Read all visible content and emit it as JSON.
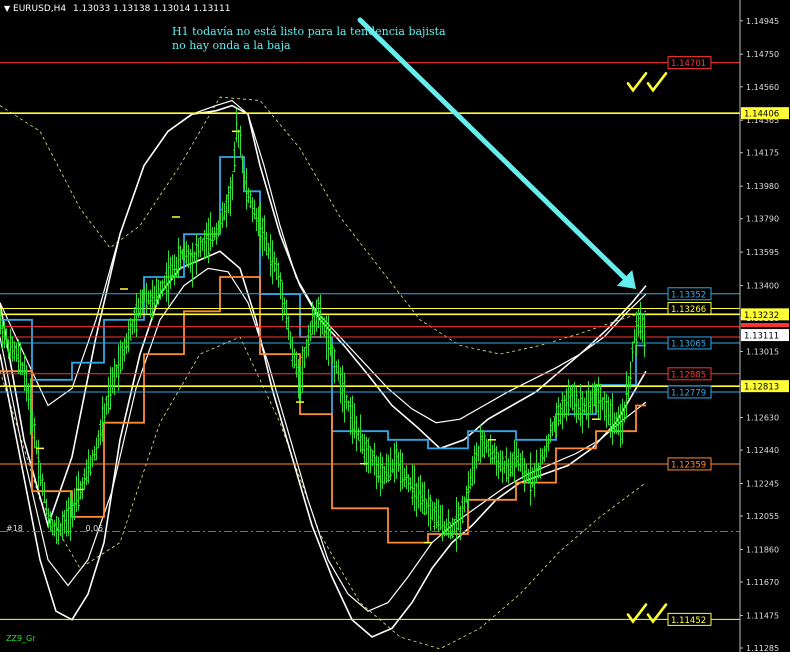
{
  "header": {
    "symbol": "EURUSD,H4",
    "ohlc": "1.13033 1.13138 1.13014 1.13111"
  },
  "note": {
    "line1": "H1 todavía no está listo para la tendencia bajista",
    "line2": "no hay onda a la baja"
  },
  "lower_left_text": "#18",
  "lower_left_value": "0.05",
  "footer_text": "ZZ9_Gr",
  "colors": {
    "background": "#000000",
    "candles": "#33dd33",
    "yellow": "#ffff33",
    "red": "#ff3333",
    "blue": "#33a8e8",
    "orange": "#ff8c33",
    "white": "#ffffff",
    "arrow": "#66eeee"
  },
  "chart_data": {
    "type": "line",
    "ylim": [
      1.11285,
      1.15043
    ],
    "y_ticks": [
      "1.14945",
      "1.14750",
      "1.14560",
      "1.14365",
      "1.14175",
      "1.13980",
      "1.13790",
      "1.13595",
      "1.13400",
      "1.13210",
      "1.13015",
      "1.12825",
      "1.12630",
      "1.12440",
      "1.12245",
      "1.12055",
      "1.11860",
      "1.11670",
      "1.11475",
      "1.11285"
    ],
    "current_price": "1.13111",
    "price_lines": [
      {
        "label": "1.14701",
        "value": 1.14701,
        "color": "#ff3333",
        "style": "boxed-right"
      },
      {
        "label": "1.14406",
        "value": 1.14406,
        "color": "#ffff33",
        "style": "axis-tag"
      },
      {
        "label": "1.13352",
        "value": 1.13352,
        "color": "#33a8e8",
        "style": "boxed-right"
      },
      {
        "label": "1.13266",
        "value": 1.13266,
        "color": "#ffff33",
        "style": "boxed-right"
      },
      {
        "label": "1.13232",
        "value": 1.13232,
        "color": "#ffff33",
        "style": "axis-tag"
      },
      {
        "label": "1.13065",
        "value": 1.13065,
        "color": "#33a8e8",
        "style": "boxed-right"
      },
      {
        "label": "1.12885",
        "value": 1.12885,
        "color": "#ff3333",
        "style": "boxed-right"
      },
      {
        "label": "1.12813",
        "value": 1.12813,
        "color": "#ffff33",
        "style": "axis-tag"
      },
      {
        "label": "1.12779",
        "value": 1.12779,
        "color": "#33a8e8",
        "style": "boxed-right"
      },
      {
        "label": "1.12359",
        "value": 1.12359,
        "color": "#ff8c33",
        "style": "boxed-right"
      },
      {
        "label": "1.11452",
        "value": 1.11452,
        "color": "#ffff33",
        "style": "boxed-right"
      }
    ],
    "unlabeled_lines": [
      {
        "value": 1.1316,
        "color": "#ff3333"
      },
      {
        "value": 1.131,
        "color": "#ff3333"
      },
      {
        "value": 1.11965,
        "color": "#ff3333",
        "dash": true
      }
    ],
    "price_path": [
      [
        0,
        1.1317
      ],
      [
        4,
        1.1305
      ],
      [
        8,
        1.13
      ],
      [
        12,
        1.129
      ],
      [
        16,
        1.1262
      ],
      [
        20,
        1.123
      ],
      [
        24,
        1.1205
      ],
      [
        28,
        1.1196
      ],
      [
        32,
        1.1201
      ],
      [
        36,
        1.121
      ],
      [
        40,
        1.122
      ],
      [
        44,
        1.1232
      ],
      [
        48,
        1.1245
      ],
      [
        52,
        1.1265
      ],
      [
        56,
        1.1283
      ],
      [
        60,
        1.1298
      ],
      [
        64,
        1.131
      ],
      [
        68,
        1.1322
      ],
      [
        72,
        1.1335
      ],
      [
        76,
        1.133
      ],
      [
        80,
        1.1338
      ],
      [
        84,
        1.1345
      ],
      [
        88,
        1.1352
      ],
      [
        92,
        1.136
      ],
      [
        96,
        1.1355
      ],
      [
        100,
        1.1363
      ],
      [
        104,
        1.1366
      ],
      [
        108,
        1.1372
      ],
      [
        112,
        1.1382
      ],
      [
        116,
        1.1398
      ],
      [
        118,
        1.143
      ],
      [
        120,
        1.1425
      ],
      [
        122,
        1.14
      ],
      [
        126,
        1.1385
      ],
      [
        130,
        1.1375
      ],
      [
        134,
        1.136
      ],
      [
        138,
        1.135
      ],
      [
        142,
        1.133
      ],
      [
        146,
        1.13
      ],
      [
        150,
        1.1285
      ],
      [
        154,
        1.131
      ],
      [
        158,
        1.1325
      ],
      [
        162,
        1.1315
      ],
      [
        166,
        1.13
      ],
      [
        170,
        1.1285
      ],
      [
        174,
        1.127
      ],
      [
        178,
        1.1255
      ],
      [
        182,
        1.1245
      ],
      [
        186,
        1.124
      ],
      [
        190,
        1.1228
      ],
      [
        194,
        1.1232
      ],
      [
        198,
        1.1238
      ],
      [
        202,
        1.123
      ],
      [
        206,
        1.1222
      ],
      [
        210,
        1.1215
      ],
      [
        214,
        1.121
      ],
      [
        218,
        1.1205
      ],
      [
        222,
        1.12
      ],
      [
        226,
        1.1198
      ],
      [
        230,
        1.1205
      ],
      [
        234,
        1.1222
      ],
      [
        238,
        1.124
      ],
      [
        242,
        1.1248
      ],
      [
        246,
        1.1242
      ],
      [
        250,
        1.1236
      ],
      [
        254,
        1.1232
      ],
      [
        258,
        1.124
      ],
      [
        262,
        1.123
      ],
      [
        266,
        1.1228
      ],
      [
        270,
        1.1235
      ],
      [
        274,
        1.125
      ],
      [
        278,
        1.1262
      ],
      [
        282,
        1.127
      ],
      [
        286,
        1.1275
      ],
      [
        290,
        1.1268
      ],
      [
        294,
        1.1272
      ],
      [
        298,
        1.1276
      ],
      [
        302,
        1.127
      ],
      [
        306,
        1.1262
      ],
      [
        310,
        1.1256
      ],
      [
        314,
        1.128
      ],
      [
        317,
        1.131
      ],
      [
        320,
        1.1318
      ],
      [
        323,
        1.1312
      ]
    ],
    "bands": {
      "outer_upper": [
        [
          0,
          1.133
        ],
        [
          12,
          1.125
        ],
        [
          24,
          1.12
        ],
        [
          36,
          1.124
        ],
        [
          48,
          1.131
        ],
        [
          60,
          1.137
        ],
        [
          72,
          1.141
        ],
        [
          84,
          1.143
        ],
        [
          96,
          1.144
        ],
        [
          108,
          1.1442
        ],
        [
          116,
          1.1445
        ],
        [
          124,
          1.144
        ],
        [
          130,
          1.141
        ],
        [
          140,
          1.137
        ],
        [
          150,
          1.134
        ],
        [
          160,
          1.132
        ],
        [
          172,
          1.1305
        ],
        [
          184,
          1.1288
        ],
        [
          196,
          1.127
        ],
        [
          208,
          1.1258
        ],
        [
          220,
          1.1245
        ],
        [
          232,
          1.125
        ],
        [
          244,
          1.1262
        ],
        [
          256,
          1.127
        ],
        [
          268,
          1.1278
        ],
        [
          280,
          1.129
        ],
        [
          292,
          1.1302
        ],
        [
          304,
          1.1315
        ],
        [
          316,
          1.133
        ],
        [
          323,
          1.134
        ]
      ],
      "outer_lower": [
        [
          0,
          1.13
        ],
        [
          10,
          1.124
        ],
        [
          20,
          1.118
        ],
        [
          28,
          1.115
        ],
        [
          36,
          1.1145
        ],
        [
          44,
          1.116
        ],
        [
          52,
          1.119
        ],
        [
          60,
          1.125
        ],
        [
          70,
          1.13
        ],
        [
          80,
          1.1335
        ],
        [
          90,
          1.135
        ],
        [
          100,
          1.1355
        ],
        [
          110,
          1.136
        ],
        [
          120,
          1.135
        ],
        [
          128,
          1.132
        ],
        [
          136,
          1.128
        ],
        [
          146,
          1.124
        ],
        [
          156,
          1.12
        ],
        [
          166,
          1.117
        ],
        [
          176,
          1.1145
        ],
        [
          186,
          1.1135
        ],
        [
          196,
          1.114
        ],
        [
          206,
          1.1155
        ],
        [
          216,
          1.1175
        ],
        [
          226,
          1.119
        ],
        [
          236,
          1.12
        ],
        [
          248,
          1.1215
        ],
        [
          260,
          1.1225
        ],
        [
          272,
          1.123
        ],
        [
          284,
          1.1235
        ],
        [
          296,
          1.1245
        ],
        [
          308,
          1.126
        ],
        [
          318,
          1.128
        ],
        [
          323,
          1.129
        ]
      ],
      "inner_upper": [
        [
          0,
          1.133
        ],
        [
          12,
          1.13
        ],
        [
          24,
          1.127
        ],
        [
          36,
          1.128
        ],
        [
          48,
          1.132
        ],
        [
          60,
          1.137
        ],
        [
          72,
          1.141
        ],
        [
          84,
          1.143
        ],
        [
          96,
          1.144
        ],
        [
          108,
          1.1445
        ],
        [
          116,
          1.1448
        ],
        [
          124,
          1.144
        ],
        [
          132,
          1.141
        ],
        [
          140,
          1.1375
        ],
        [
          148,
          1.1345
        ],
        [
          158,
          1.1325
        ],
        [
          170,
          1.131
        ],
        [
          182,
          1.1295
        ],
        [
          194,
          1.128
        ],
        [
          206,
          1.1268
        ],
        [
          218,
          1.126
        ],
        [
          230,
          1.1262
        ],
        [
          242,
          1.127
        ],
        [
          254,
          1.1278
        ],
        [
          266,
          1.1285
        ],
        [
          278,
          1.1292
        ],
        [
          290,
          1.13
        ],
        [
          302,
          1.131
        ],
        [
          314,
          1.1325
        ],
        [
          323,
          1.1335
        ]
      ],
      "inner_lower": [
        [
          0,
          1.131
        ],
        [
          12,
          1.124
        ],
        [
          24,
          1.118
        ],
        [
          34,
          1.1165
        ],
        [
          44,
          1.118
        ],
        [
          56,
          1.122
        ],
        [
          68,
          1.128
        ],
        [
          80,
          1.132
        ],
        [
          92,
          1.134
        ],
        [
          104,
          1.135
        ],
        [
          114,
          1.1348
        ],
        [
          124,
          1.133
        ],
        [
          134,
          1.1295
        ],
        [
          144,
          1.1255
        ],
        [
          154,
          1.1215
        ],
        [
          164,
          1.118
        ],
        [
          174,
          1.116
        ],
        [
          184,
          1.115
        ],
        [
          194,
          1.1155
        ],
        [
          204,
          1.117
        ],
        [
          216,
          1.119
        ],
        [
          228,
          1.1202
        ],
        [
          240,
          1.1212
        ],
        [
          252,
          1.1222
        ],
        [
          264,
          1.123
        ],
        [
          276,
          1.1236
        ],
        [
          288,
          1.1242
        ],
        [
          300,
          1.125
        ],
        [
          312,
          1.1262
        ],
        [
          323,
          1.1272
        ]
      ],
      "dashed_upper": [
        [
          0,
          1.1445
        ],
        [
          20,
          1.143
        ],
        [
          40,
          1.1385
        ],
        [
          55,
          1.1362
        ],
        [
          70,
          1.1375
        ],
        [
          90,
          1.141
        ],
        [
          110,
          1.145
        ],
        [
          130,
          1.1448
        ],
        [
          150,
          1.142
        ],
        [
          170,
          1.138
        ],
        [
          190,
          1.135
        ],
        [
          210,
          1.132
        ],
        [
          230,
          1.1305
        ],
        [
          250,
          1.13
        ],
        [
          270,
          1.1305
        ],
        [
          290,
          1.1312
        ],
        [
          310,
          1.132
        ],
        [
          323,
          1.1325
        ]
      ],
      "dashed_lower": [
        [
          0,
          1.129
        ],
        [
          20,
          1.1215
        ],
        [
          40,
          1.1175
        ],
        [
          60,
          1.119
        ],
        [
          80,
          1.126
        ],
        [
          100,
          1.13
        ],
        [
          120,
          1.131
        ],
        [
          140,
          1.126
        ],
        [
          160,
          1.1195
        ],
        [
          180,
          1.1155
        ],
        [
          200,
          1.1135
        ],
        [
          220,
          1.1128
        ],
        [
          240,
          1.114
        ],
        [
          260,
          1.116
        ],
        [
          280,
          1.1185
        ],
        [
          300,
          1.1205
        ],
        [
          323,
          1.1225
        ]
      ]
    },
    "steps": {
      "blue_upper": [
        [
          0,
          1.132
        ],
        [
          16,
          1.132
        ],
        [
          16,
          1.1285
        ],
        [
          36,
          1.1285
        ],
        [
          36,
          1.1295
        ],
        [
          52,
          1.1295
        ],
        [
          52,
          1.132
        ],
        [
          72,
          1.132
        ],
        [
          72,
          1.1345
        ],
        [
          92,
          1.1345
        ],
        [
          92,
          1.137
        ],
        [
          110,
          1.137
        ],
        [
          110,
          1.1415
        ],
        [
          122,
          1.1415
        ],
        [
          122,
          1.1395
        ],
        [
          130,
          1.1395
        ],
        [
          130,
          1.1335
        ],
        [
          150,
          1.1335
        ],
        [
          150,
          1.131
        ],
        [
          166,
          1.131
        ],
        [
          166,
          1.1255
        ],
        [
          194,
          1.1255
        ],
        [
          194,
          1.125
        ],
        [
          214,
          1.125
        ],
        [
          214,
          1.1245
        ],
        [
          234,
          1.1245
        ],
        [
          234,
          1.1255
        ],
        [
          258,
          1.1255
        ],
        [
          258,
          1.125
        ],
        [
          278,
          1.125
        ],
        [
          278,
          1.1265
        ],
        [
          298,
          1.1265
        ],
        [
          298,
          1.1282
        ],
        [
          318,
          1.1282
        ],
        [
          318,
          1.1305
        ],
        [
          323,
          1.1305
        ]
      ],
      "orange_lower": [
        [
          0,
          1.129
        ],
        [
          16,
          1.129
        ],
        [
          16,
          1.122
        ],
        [
          36,
          1.122
        ],
        [
          36,
          1.1205
        ],
        [
          52,
          1.1205
        ],
        [
          52,
          1.126
        ],
        [
          72,
          1.126
        ],
        [
          72,
          1.13
        ],
        [
          92,
          1.13
        ],
        [
          92,
          1.1325
        ],
        [
          110,
          1.1325
        ],
        [
          110,
          1.1345
        ],
        [
          130,
          1.1345
        ],
        [
          130,
          1.13
        ],
        [
          150,
          1.13
        ],
        [
          150,
          1.1265
        ],
        [
          166,
          1.1265
        ],
        [
          166,
          1.121
        ],
        [
          194,
          1.121
        ],
        [
          194,
          1.119
        ],
        [
          214,
          1.119
        ],
        [
          214,
          1.1195
        ],
        [
          234,
          1.1195
        ],
        [
          234,
          1.1215
        ],
        [
          258,
          1.1215
        ],
        [
          258,
          1.1225
        ],
        [
          278,
          1.1225
        ],
        [
          278,
          1.1245
        ],
        [
          298,
          1.1245
        ],
        [
          298,
          1.1255
        ],
        [
          318,
          1.1255
        ],
        [
          318,
          1.127
        ],
        [
          323,
          1.127
        ]
      ]
    },
    "arrow": {
      "from": [
        180,
        1.1495
      ],
      "to": [
        318,
        1.1338
      ]
    },
    "checkmark_groups": [
      {
        "x": 318,
        "y": 1.1458,
        "count": 2
      },
      {
        "x": 318,
        "y": 1.1148,
        "count": 2
      }
    ],
    "grid": false
  }
}
